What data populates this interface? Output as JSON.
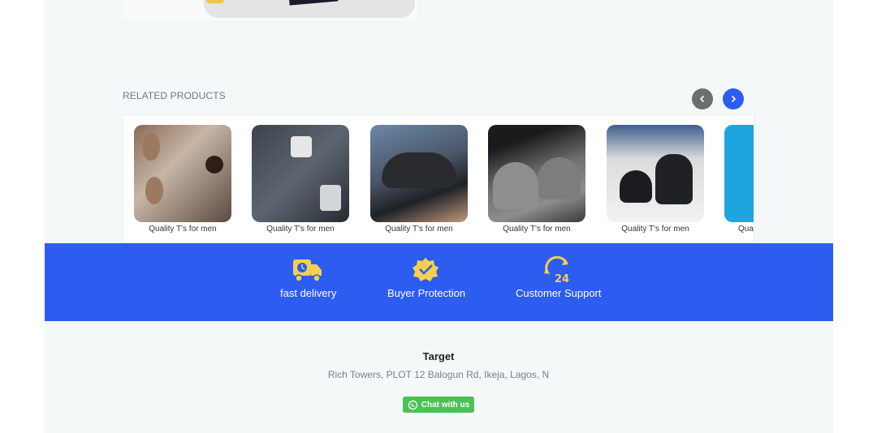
{
  "related": {
    "title": "RELATED PRODUCTS",
    "prev_icon": "chevron-left-icon",
    "next_icon": "chevron-right-icon",
    "products": [
      {
        "label": "Quality T's for men"
      },
      {
        "label": "Quality T's for men"
      },
      {
        "label": "Quality T's for men"
      },
      {
        "label": "Quality T's for men"
      },
      {
        "label": "Quality T's for men"
      },
      {
        "label": "Qua"
      }
    ]
  },
  "features": [
    {
      "label": "fast delivery",
      "icon": "delivery-truck-icon"
    },
    {
      "label": "Buyer Protection",
      "icon": "badge-check-icon"
    },
    {
      "label": "Customer Support",
      "icon": "support-24-icon"
    }
  ],
  "store": {
    "name": "Target",
    "address": "Rich Towers, PLOT 12 Balogun Rd, Ikeja, Lagos, N"
  },
  "chat": {
    "label": "Chat with us",
    "icon": "whatsapp-icon"
  },
  "colors": {
    "accent": "#2d5cf0",
    "icon_yellow": "#f6d04d",
    "chat_green": "#4cc154"
  }
}
